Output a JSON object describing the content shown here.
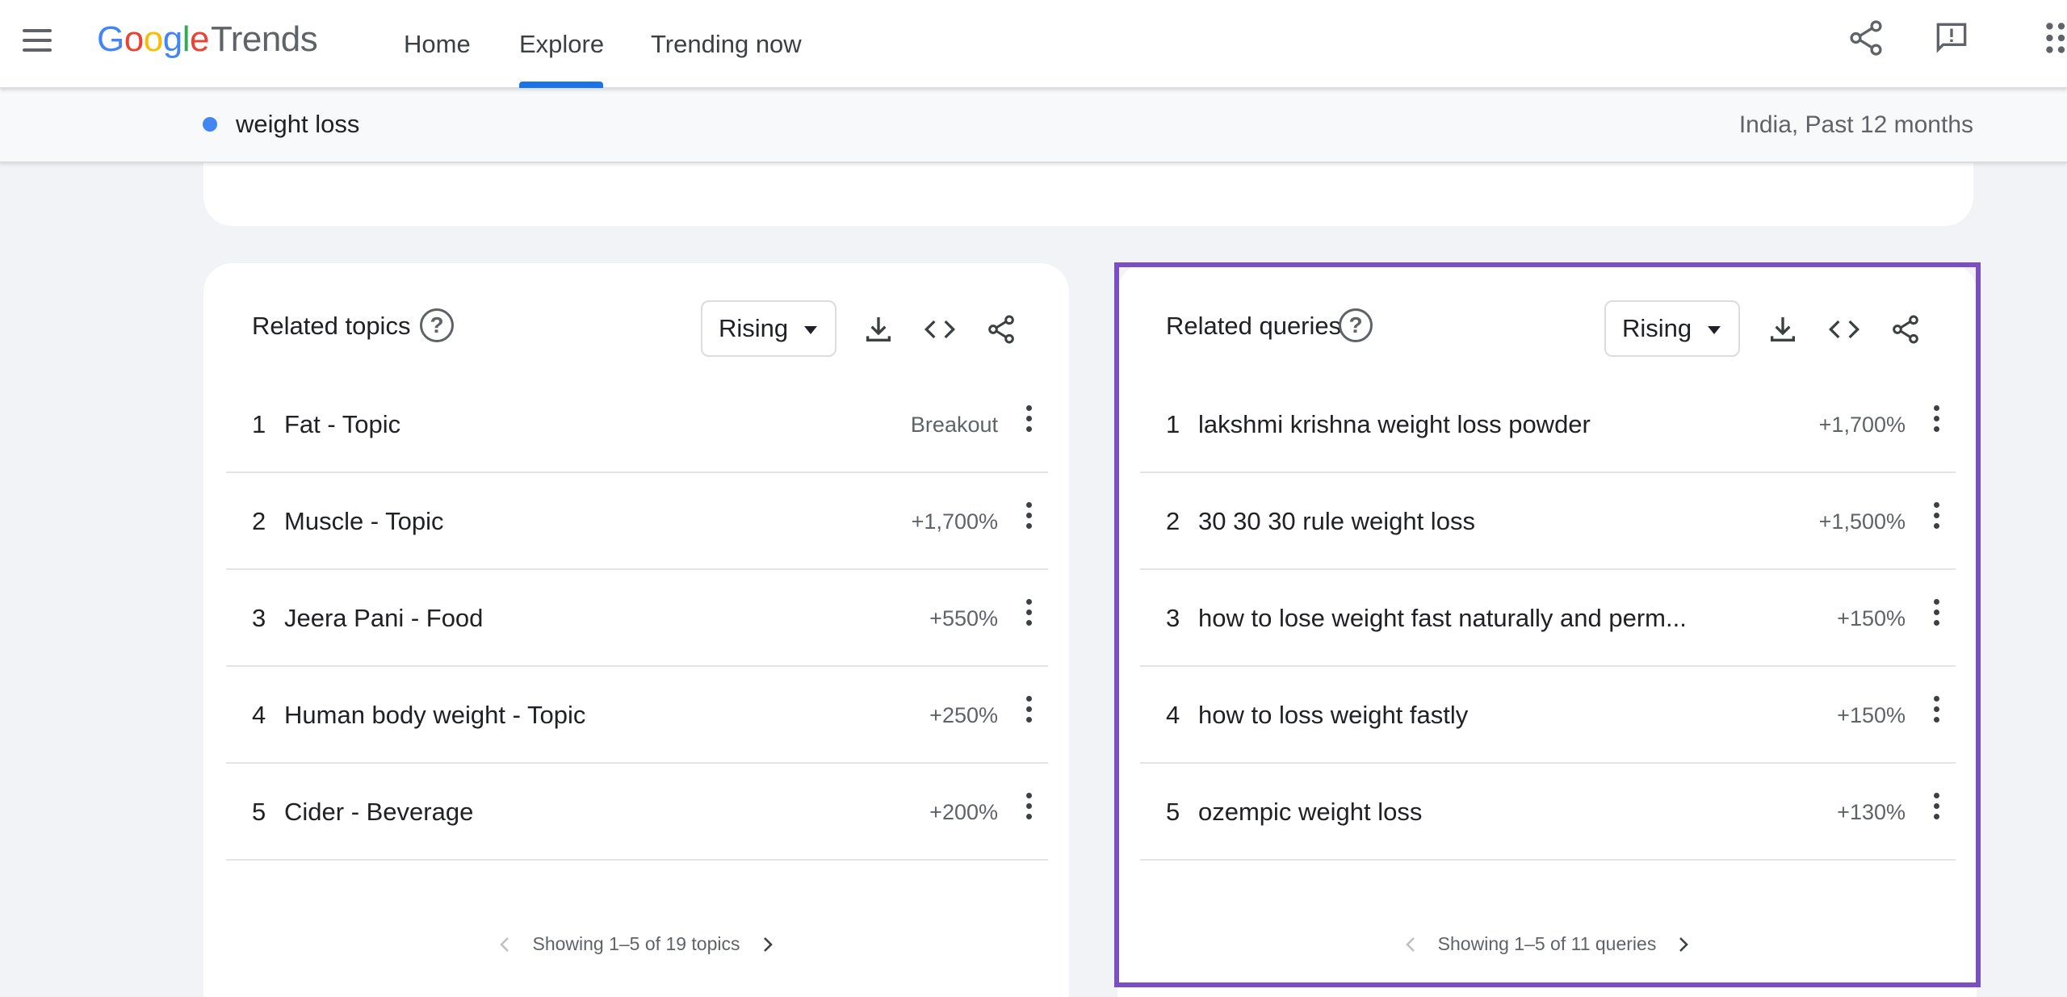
{
  "header": {
    "logo_google": "Google",
    "logo_trends": "Trends",
    "nav": [
      {
        "label": "Home"
      },
      {
        "label": "Explore"
      },
      {
        "label": "Trending now"
      }
    ],
    "active_nav": "Explore"
  },
  "subheader": {
    "term": "weight loss",
    "term_color": "#4285f4",
    "region_period": "India, Past 12 months"
  },
  "related_topics": {
    "title": "Related topics",
    "filter": "Rising",
    "rows": [
      {
        "rank": "1",
        "label": "Fat - Topic",
        "value": "Breakout"
      },
      {
        "rank": "2",
        "label": "Muscle - Topic",
        "value": "+1,700%"
      },
      {
        "rank": "3",
        "label": "Jeera Pani - Food",
        "value": "+550%"
      },
      {
        "rank": "4",
        "label": "Human body weight - Topic",
        "value": "+250%"
      },
      {
        "rank": "5",
        "label": "Cider - Beverage",
        "value": "+200%"
      }
    ],
    "pager": "Showing 1–5 of 19 topics"
  },
  "related_queries": {
    "title": "Related queries",
    "filter": "Rising",
    "rows": [
      {
        "rank": "1",
        "label": "lakshmi krishna weight loss powder",
        "value": "+1,700%"
      },
      {
        "rank": "2",
        "label": "30 30 30 rule weight loss",
        "value": "+1,500%"
      },
      {
        "rank": "3",
        "label": "how to lose weight fast naturally and perm...",
        "value": "+150%"
      },
      {
        "rank": "4",
        "label": "how to loss weight fastly",
        "value": "+150%"
      },
      {
        "rank": "5",
        "label": "ozempic weight loss",
        "value": "+130%"
      }
    ],
    "pager": "Showing 1–5 of 11 queries"
  },
  "icons": {
    "menu": "menu-icon",
    "share": "share-icon",
    "feedback": "feedback-icon",
    "apps": "apps-grid-icon",
    "help": "help-icon",
    "download": "download-icon",
    "embed": "embed-code-icon",
    "more": "more-vert-icon",
    "prev": "chevron-left-icon",
    "next": "chevron-right-icon"
  },
  "colors": {
    "accent": "#1a73e8",
    "highlight_border": "#7b4fc3"
  }
}
